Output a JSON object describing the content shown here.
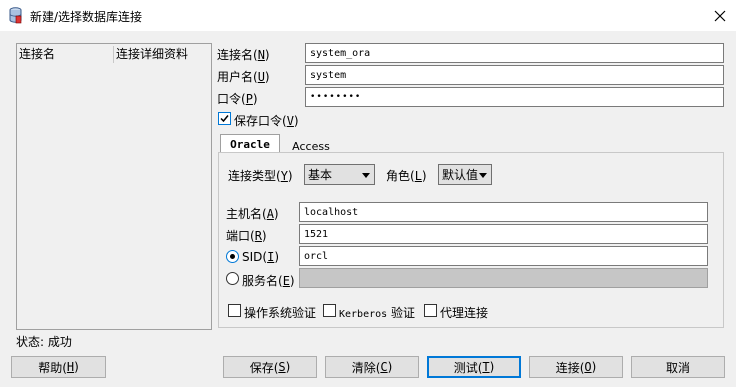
{
  "window": {
    "title": "新建/选择数据库连接"
  },
  "connection_list": {
    "columns": [
      "连接名",
      "连接详细资料"
    ]
  },
  "form": {
    "conn_name": {
      "label": "连接名(",
      "key": "N",
      "value": "system_ora"
    },
    "username": {
      "label": "用户名(",
      "key": "U",
      "value": "system"
    },
    "password": {
      "label": "口令(",
      "key": "P",
      "value": "••••••••"
    },
    "save_password": {
      "label": "保存口令(",
      "key": "V",
      "checked": true
    }
  },
  "tabs": [
    {
      "label": "Oracle",
      "active": true
    },
    {
      "label": "Access",
      "active": false
    }
  ],
  "oracle": {
    "conn_type": {
      "label": "连接类型(",
      "key": "Y",
      "value": "基本"
    },
    "role": {
      "label": "角色(",
      "key": "L",
      "value": "默认值"
    },
    "host": {
      "label": "主机名(",
      "key": "A",
      "value": "localhost"
    },
    "port": {
      "label": "端口(",
      "key": "R",
      "value": "1521"
    },
    "sid": {
      "label": "SID(",
      "key": "I",
      "value": "orcl",
      "selected": true
    },
    "service": {
      "label": "服务名(",
      "key": "E",
      "value": "",
      "selected": false
    },
    "os_auth": {
      "label": "操作系统验证",
      "checked": false
    },
    "kerberos": {
      "label_prefix": "Kerberos",
      "label_suffix": " 验证",
      "checked": false
    },
    "proxy": {
      "label": "代理连接",
      "checked": false
    }
  },
  "status": {
    "text": "状态: 成功"
  },
  "buttons": {
    "help": {
      "label": "帮助(",
      "key": "H"
    },
    "save": {
      "label": "保存(",
      "key": "S"
    },
    "clear": {
      "label": "清除(",
      "key": "C"
    },
    "test": {
      "label": "测试(",
      "key": "T"
    },
    "connect": {
      "label": "连接(",
      "key": "O"
    },
    "cancel": {
      "label": "取消"
    }
  },
  "colors": {
    "accent": "#0078d7",
    "title_bg": "#ffffff",
    "dialog_bg": "#f0f0f0"
  },
  "icons": {
    "app": "database-icon",
    "close": "close-icon",
    "check": "check-icon"
  }
}
